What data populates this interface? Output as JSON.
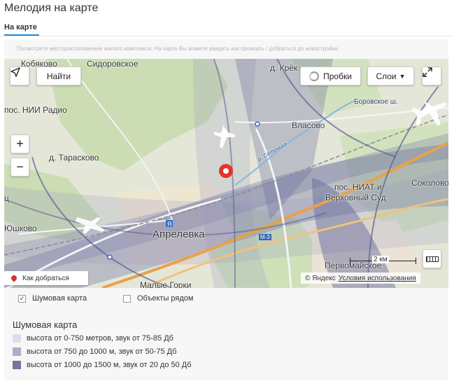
{
  "header": {
    "title": "Мелодия на карте",
    "tab_label": "На карте"
  },
  "hint": "Посмотрите месторасположение жилого комплекса. На карте Вы можете увидеть как проехать / добраться до новостройки",
  "map": {
    "find_button": "Найти",
    "traffic_button": "Пробки",
    "layers_button": "Слои",
    "directions_link": "Как добраться",
    "scale_label": "2 км",
    "copyright": "© Яндекс",
    "terms_link": "Условия использования",
    "place_labels": {
      "kobyakovo": "Кобяково",
      "sidorovskoe": "Сидоровское",
      "krekshino": "д. Крёк",
      "nii_radio": "пос. НИИ Радио",
      "tarasovo": "д. Тарасково",
      "vlasovo": "Власово",
      "borovskoe": "Боровское ш.",
      "sokolovo": "Соколово",
      "niat": "пос. НИАТ и",
      "court": "Верховный Суд",
      "yushkovo": "Юшково",
      "aprelevka": "Апрелевка",
      "m3": "М-3",
      "pervomaiskoe": "Первомайское",
      "malye_gorki": "Малые Горки",
      "setun": "р. Сетунька",
      "edge_left1": "ц",
      "edge_left2": "ос"
    },
    "noise_colors": {
      "light": "#c4c4dc",
      "mid": "#9494bd",
      "dark": "#62649a"
    }
  },
  "layers": {
    "noise_map": {
      "label": "Шумовая карта",
      "checked": true
    },
    "nearby_objects": {
      "label": "Объекты рядом",
      "checked": false
    }
  },
  "legend": {
    "title": "Шумовая карта",
    "items": [
      {
        "label": "высота от 0-750 метров, звук от 75-85 Дб",
        "color": "#dddde7"
      },
      {
        "label": "высота от 750 до 1000 м, звук от 50-75 Дб",
        "color": "#aeadcb"
      },
      {
        "label": "высота от 1000 до 1500 м, звук от 20 до 50 Дб",
        "color": "#75739f"
      }
    ]
  }
}
